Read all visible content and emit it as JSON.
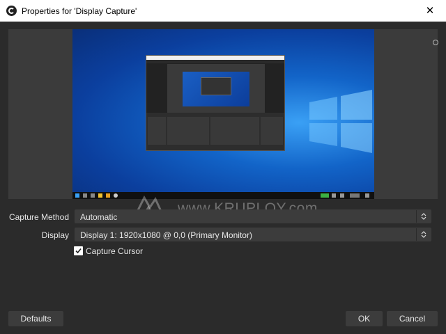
{
  "window": {
    "title": "Properties for 'Display Capture'",
    "close_glyph": "✕",
    "icon": "obs-icon"
  },
  "watermark": {
    "text": "www.KRUPLOY.com"
  },
  "form": {
    "capture_method": {
      "label": "Capture Method",
      "value": "Automatic"
    },
    "display": {
      "label": "Display",
      "value": "Display 1: 1920x1080 @ 0,0 (Primary Monitor)"
    },
    "capture_cursor": {
      "label": "Capture Cursor",
      "checked": true
    }
  },
  "buttons": {
    "defaults": "Defaults",
    "ok": "OK",
    "cancel": "Cancel"
  },
  "colors": {
    "dialog_bg": "#2b2b2b",
    "control_bg": "#3c3c3c",
    "text": "#e6e6e6"
  }
}
